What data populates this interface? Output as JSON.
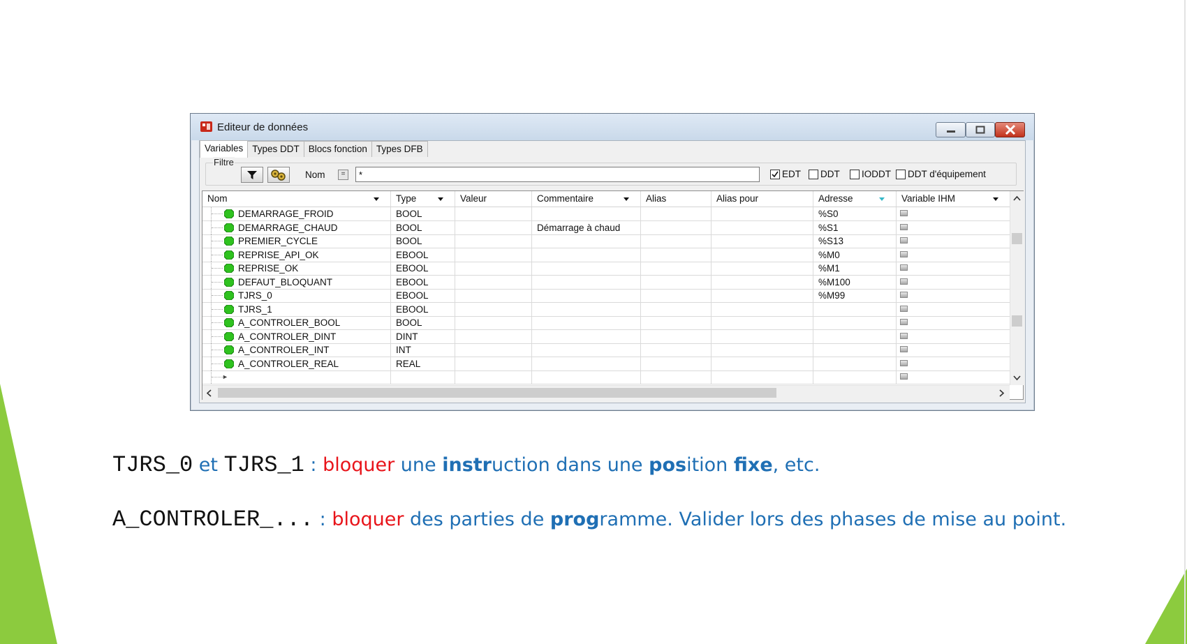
{
  "colors": {
    "accent_green": "#8ccb3e",
    "blue_text": "#1f6fb4",
    "red_text": "#e8141a"
  },
  "window": {
    "title": "Editeur de données",
    "icon": "app-logo-icon",
    "controls": {
      "minimize": "minimize-icon",
      "maximize": "maximize-icon",
      "close": "close-icon"
    }
  },
  "tabs": [
    {
      "label": "Variables",
      "active": true
    },
    {
      "label": "Types DDT",
      "active": false
    },
    {
      "label": "Blocs fonction",
      "active": false
    },
    {
      "label": "Types DFB",
      "active": false
    }
  ],
  "filter": {
    "legend": "Filtre",
    "filter_icon": "funnel-icon",
    "options_icon": "gear-cluster-icon",
    "nom_label": "Nom",
    "eq_label": "=",
    "nom_value": "*",
    "checkboxes": [
      {
        "label": "EDT",
        "checked": true
      },
      {
        "label": "DDT",
        "checked": false
      },
      {
        "label": "IODDT",
        "checked": false
      },
      {
        "label": "DDT d'équipement",
        "checked": false
      }
    ]
  },
  "table": {
    "columns": [
      "Nom",
      "Type",
      "Valeur",
      "Commentaire",
      "Alias",
      "Alias pour",
      "Adresse",
      "Variable IHM"
    ],
    "rows": [
      {
        "nom": "DEMARRAGE_FROID",
        "type": "BOOL",
        "valeur": "",
        "commentaire": "",
        "alias": "",
        "alias_pour": "",
        "adresse": "%S0"
      },
      {
        "nom": "DEMARRAGE_CHAUD",
        "type": "BOOL",
        "valeur": "",
        "commentaire": "Démarrage à chaud",
        "alias": "",
        "alias_pour": "",
        "adresse": "%S1"
      },
      {
        "nom": "PREMIER_CYCLE",
        "type": "BOOL",
        "valeur": "",
        "commentaire": "",
        "alias": "",
        "alias_pour": "",
        "adresse": "%S13"
      },
      {
        "nom": "REPRISE_API_OK",
        "type": "EBOOL",
        "valeur": "",
        "commentaire": "",
        "alias": "",
        "alias_pour": "",
        "adresse": "%M0"
      },
      {
        "nom": "REPRISE_OK",
        "type": "EBOOL",
        "valeur": "",
        "commentaire": "",
        "alias": "",
        "alias_pour": "",
        "adresse": "%M1"
      },
      {
        "nom": "DEFAUT_BLOQUANT",
        "type": "EBOOL",
        "valeur": "",
        "commentaire": "",
        "alias": "",
        "alias_pour": "",
        "adresse": "%M100"
      },
      {
        "nom": "TJRS_0",
        "type": "EBOOL",
        "valeur": "",
        "commentaire": "",
        "alias": "",
        "alias_pour": "",
        "adresse": "%M99"
      },
      {
        "nom": "TJRS_1",
        "type": "EBOOL",
        "valeur": "",
        "commentaire": "",
        "alias": "",
        "alias_pour": "",
        "adresse": ""
      },
      {
        "nom": "A_CONTROLER_BOOL",
        "type": "BOOL",
        "valeur": "",
        "commentaire": "",
        "alias": "",
        "alias_pour": "",
        "adresse": ""
      },
      {
        "nom": "A_CONTROLER_DINT",
        "type": "DINT",
        "valeur": "",
        "commentaire": "",
        "alias": "",
        "alias_pour": "",
        "adresse": ""
      },
      {
        "nom": "A_CONTROLER_INT",
        "type": "INT",
        "valeur": "",
        "commentaire": "",
        "alias": "",
        "alias_pour": "",
        "adresse": ""
      },
      {
        "nom": "A_CONTROLER_REAL",
        "type": "REAL",
        "valeur": "",
        "commentaire": "",
        "alias": "",
        "alias_pour": "",
        "adresse": ""
      }
    ],
    "new_row_marker": "►"
  },
  "slide": {
    "line1": {
      "code1": "TJRS_0",
      "sep1": " et ",
      "code2": "TJRS_1",
      "colon": " : ",
      "red": "bloquer",
      "t1": " une ",
      "b1": "instr",
      "t2": "uction dans une ",
      "b2": "pos",
      "t3": "ition ",
      "b3": "fixe",
      "t4": ", etc."
    },
    "line2": {
      "code": "A_CONTROLER_...",
      "colon": " : ",
      "red": "bloquer",
      "t1": " des parties de ",
      "b1": "prog",
      "t2": "ramme. Valider lors des phases de mise au point."
    }
  }
}
